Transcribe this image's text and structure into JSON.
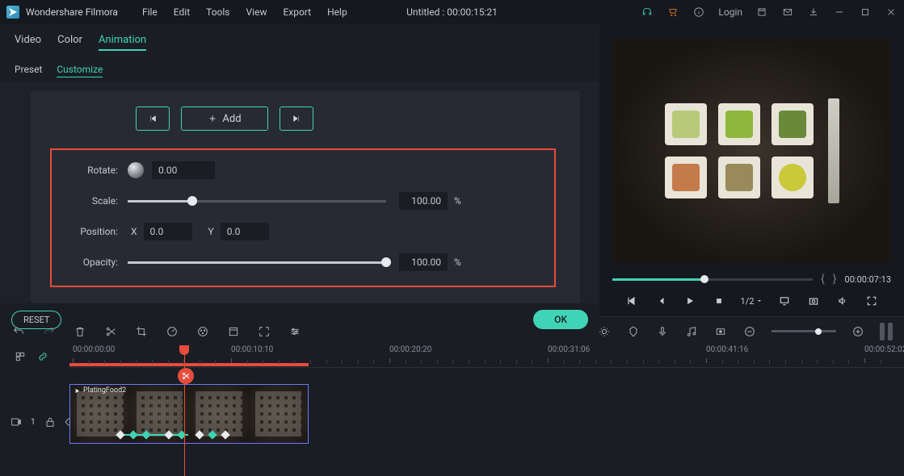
{
  "app_name": "Wondershare Filmora",
  "menus": [
    "File",
    "Edit",
    "Tools",
    "View",
    "Export",
    "Help"
  ],
  "title": "Untitled : 00:00:15:21",
  "login": "Login",
  "tabs": {
    "video": "Video",
    "color": "Color",
    "animation": "Animation"
  },
  "subtabs": {
    "preset": "Preset",
    "customize": "Customize"
  },
  "anim": {
    "add": "Add",
    "rotate_label": "Rotate:",
    "rotate_val": "0.00",
    "scale_label": "Scale:",
    "scale_val": "100.00",
    "scale_unit": "%",
    "position_label": "Position:",
    "x_label": "X",
    "x_val": "0.0",
    "y_label": "Y",
    "y_val": "0.0",
    "opacity_label": "Opacity:",
    "opacity_val": "100.00",
    "opacity_unit": "%"
  },
  "buttons": {
    "reset": "RESET",
    "ok": "OK"
  },
  "preview": {
    "timecode": "00:00:07:13",
    "speed": "1/2"
  },
  "ruler": [
    "00:00:00:00",
    "00:00:10:10",
    "00:00:20:20",
    "00:00:31:06",
    "00:00:41:16",
    "00:00:52:02"
  ],
  "clip": {
    "name": "PlatingFood2"
  },
  "track_label": "1"
}
